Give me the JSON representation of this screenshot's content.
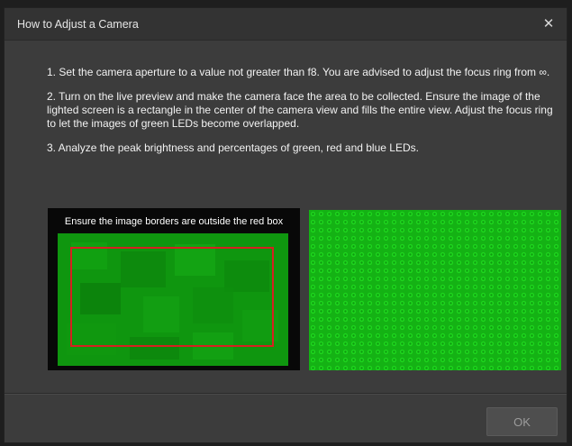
{
  "dialog": {
    "title": "How to Adjust a Camera",
    "close_icon": "close-icon"
  },
  "steps": [
    "1. Set the camera aperture to a value not greater than f8. You are advised to adjust the focus ring from ∞.",
    "2. Turn on the live preview and make the camera face the area to be collected. Ensure the image of the lighted screen is a rectangle in the center of the camera view and fills the entire view. Adjust the focus ring to let the images of green LEDs become overlapped.",
    "3. Analyze the peak brightness and percentages of green, red and blue LEDs."
  ],
  "images": {
    "left_caption": "Ensure the image borders are outside the red box"
  },
  "footer": {
    "ok_label": "OK"
  },
  "colors": {
    "led_green": "#15b515",
    "red_box": "#d62020",
    "dialog_bg": "#3c3c3c"
  }
}
